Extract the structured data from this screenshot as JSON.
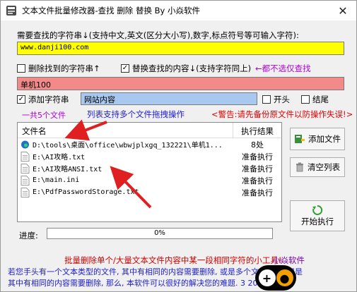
{
  "window": {
    "title": "文本文件批量修改器-查找 删除 替换 By 小焱软件",
    "close_glyph": "✕"
  },
  "find": {
    "label": "需要查找的字符串↓(支持中文,英文(区分大小写),数字,标点符号等可输入字符):",
    "value": "www.danji100.com"
  },
  "options": {
    "delete_found": {
      "label": "删除找到的字符串↑",
      "checked": false
    },
    "replace_found": {
      "label": "替换查找的内容↓(支持字符同上)",
      "checked": true
    },
    "replace_note": "←都不选仅查找"
  },
  "replace": {
    "value": "单机100"
  },
  "add_string": {
    "label": "添加字符串",
    "checked": true,
    "value": "网站内容",
    "prefix_label": "开头",
    "prefix_checked": false,
    "suffix_label": "结尾",
    "suffix_checked": false
  },
  "info": {
    "file_count": "一共5个文件",
    "drag_tip": "列表支持多个文件拖拽操作",
    "warning": "<警告:请先备份原文件以防操作失误!>"
  },
  "file_list": {
    "col_name": "文件名",
    "col_result": "执行结果",
    "rows": [
      {
        "name": "D:\\tools\\桌面\\office\\wbwjplxgq_132221\\单机1...",
        "result": "8处",
        "icon": "edge-icon"
      },
      {
        "name": "E:\\AI攻略.txt",
        "result": "准备执行",
        "icon": "file-icon"
      },
      {
        "name": "E:\\AI攻略ANSI.txt",
        "result": "准备执行",
        "icon": "file-icon"
      },
      {
        "name": "E:\\main.ini",
        "result": "准备执行",
        "icon": "file-icon"
      },
      {
        "name": "E:\\PdfPasswordStorage.txt",
        "result": "准备执行",
        "icon": "file-icon"
      }
    ]
  },
  "buttons": {
    "add_file": "添加文件",
    "clear_list": "清空列表",
    "start": "开始执行"
  },
  "progress": {
    "label": "进度:",
    "value_text": "0%",
    "value": 0
  },
  "footer": {
    "line1": "批量删除单个/大量文本文件内容中某一段相同字符的小工具!",
    "author": "小焱软件",
    "line2": "若您手头有一个文本类型的文件, 其中有相同的内容需要删除, 或是多个文本文件, 但是",
    "line3": "其中有相同的内容需要删除, 那么, 本软件可以很好的解决您的难题. 3    2007年1月"
  },
  "colors": {
    "find_bg": "#ffff00",
    "replace_bg": "#f28a8a",
    "add_bg": "#a9c8f0",
    "arrow": "#e02020"
  }
}
